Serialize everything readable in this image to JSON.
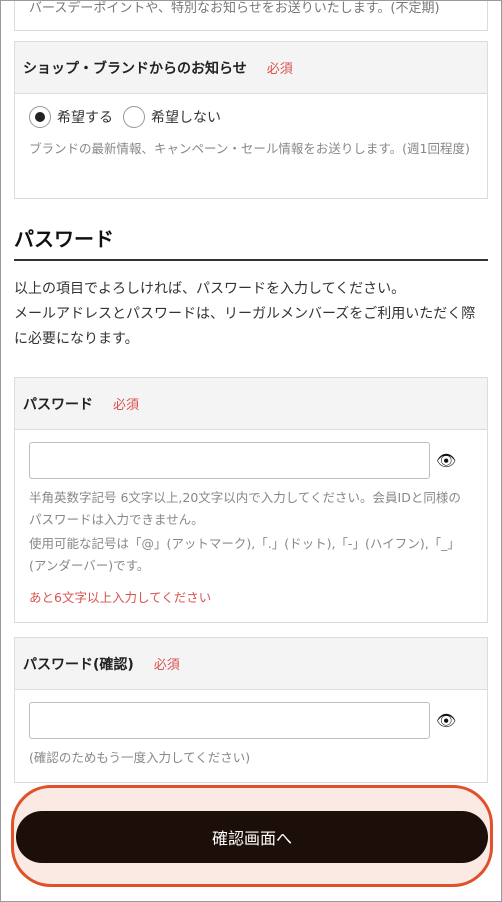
{
  "top_clipped_text": "バースデーポイントや、特別なお知らせをお送りいたします。(不定期)",
  "shop_notice": {
    "title": "ショップ・ブランドからのお知らせ",
    "required": "必須",
    "options": [
      "希望する",
      "希望しない"
    ],
    "selected": "希望する",
    "note": "ブランドの最新情報、キャンペーン・セール情報をお送りします。(週1回程度)"
  },
  "password_section": {
    "title": "パスワード",
    "intro_1": "以上の項目でよろしければ、パスワードを入力してください。",
    "intro_2": "メールアドレスとパスワードは、リーガルメンバーズをご利用いただく際に必要になります。"
  },
  "password_field": {
    "label": "パスワード",
    "required": "必須",
    "value": "",
    "hint_1": "半角英数字記号 6文字以上,20文字以内で入力してください。会員IDと同様のパスワードは入力できません。",
    "hint_2": "使用可能な記号は「@」(アットマーク),「.」(ドット),「-」(ハイフン),「_」(アンダーバー)です。",
    "warning": "あと6文字以上入力してください"
  },
  "password_confirm": {
    "label": "パスワード(確認)",
    "required": "必須",
    "value": "",
    "hint": "(確認のためもう一度入力してください)"
  },
  "confirm_button": "確認画面へ",
  "colors": {
    "accent_red": "#d9534f",
    "button_bg": "#1c0e08",
    "highlight_border": "#e0502a",
    "highlight_bg": "#fbe9e3"
  },
  "icons": {
    "show_password": "eye-icon"
  }
}
